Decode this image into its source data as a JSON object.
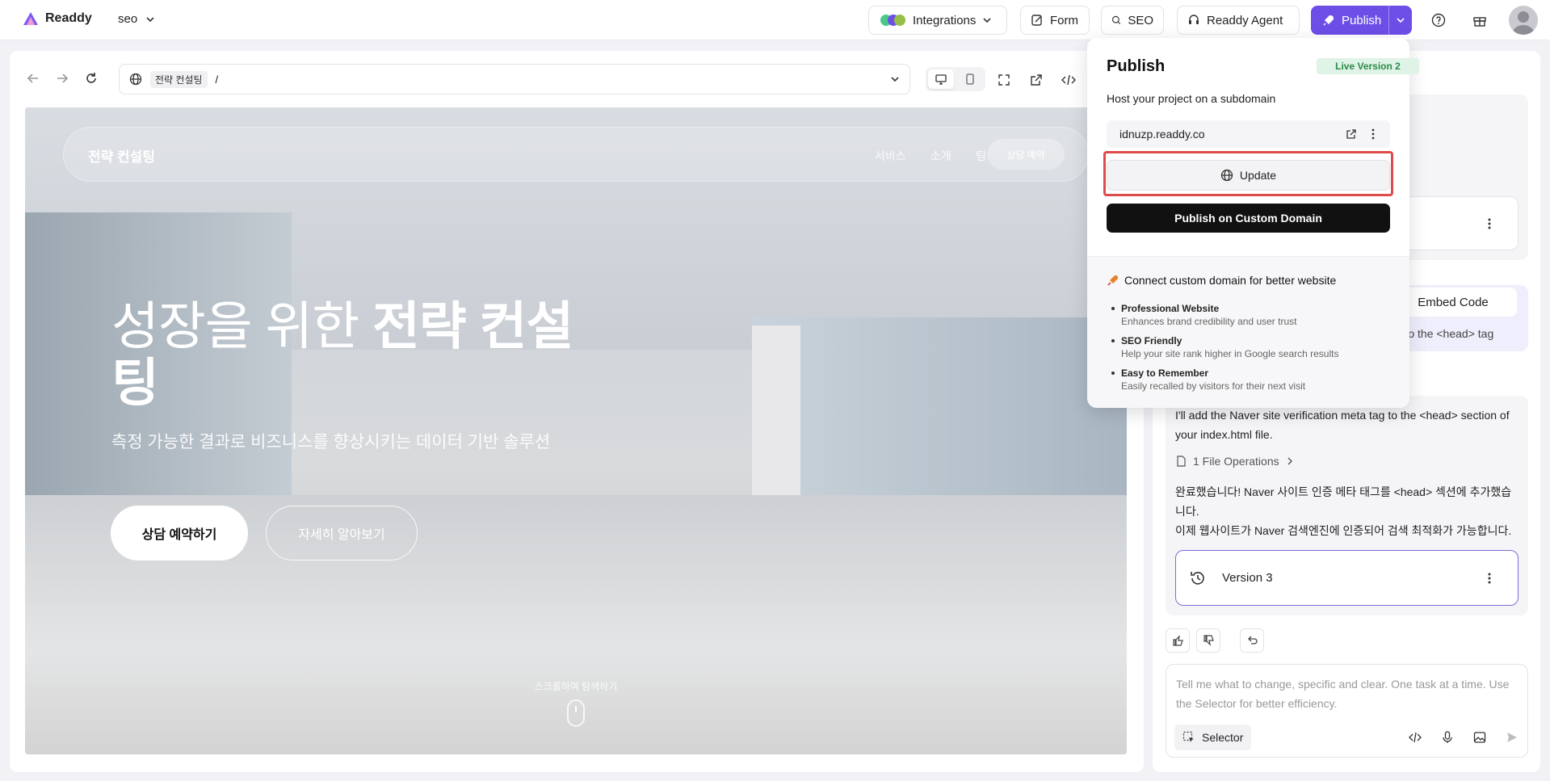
{
  "topbar": {
    "brand": "Readdy",
    "project": "seo",
    "integrations_label": "Integrations",
    "form_label": "Form",
    "seo_label": "SEO",
    "agent_label": "Readdy Agent",
    "publish_label": "Publish",
    "accent": "#6d4fe8"
  },
  "browser": {
    "site_chip": "전략 컨설팅",
    "path": "/"
  },
  "preview": {
    "nav_brand": "전략 컨설팅",
    "nav_links": [
      "서비스",
      "소개",
      "팀"
    ],
    "nav_cta": "상담 예약",
    "headline_light": "성장을 위한 ",
    "headline_bold": "전략 컨설팅",
    "subtitle": "측정 가능한 결과로 비즈니스를 향상시키는 데이터 기반 솔루션",
    "cta_primary": "상담 예약하기",
    "cta_secondary": "자세히 알아보기",
    "scroll_hint": "스크롤하여 탐색하기"
  },
  "publish_popup": {
    "title": "Publish",
    "live_badge": "Live Version 2",
    "host_text": "Host your project on a subdomain",
    "subdomain": "idnuzp.readdy.co",
    "update_label": "Update",
    "custom_domain_label": "Publish on Custom Domain",
    "connect_title": "Connect custom domain for better website",
    "features": [
      {
        "name": "Professional Website",
        "desc": "Enhances brand credibility and user trust"
      },
      {
        "name": "SEO Friendly",
        "desc": "Help your site rank higher in Google search results"
      },
      {
        "name": "Easy to Remember",
        "desc": "Easily recalled by visitors for their next visit"
      }
    ]
  },
  "chat": {
    "embed_button": "Embed Code",
    "embed_text": "nd to the <head> tag",
    "message_1": "I'll add the Naver site verification meta tag to the <head> section of your index.html file.",
    "file_ops": "1 File Operations",
    "message_2": "완료했습니다! Naver 사이트 인증 메타 태그를 <head> 섹션에 추가했습니다.",
    "message_3": "이제 웹사이트가 Naver 검색엔진에 인증되어 검색 최적화가 가능합니다.",
    "version_label": "Version 3",
    "input_placeholder": "Tell me what to change, specific and clear. One task at a time. Use the Selector for better efficiency.",
    "selector_label": "Selector"
  }
}
